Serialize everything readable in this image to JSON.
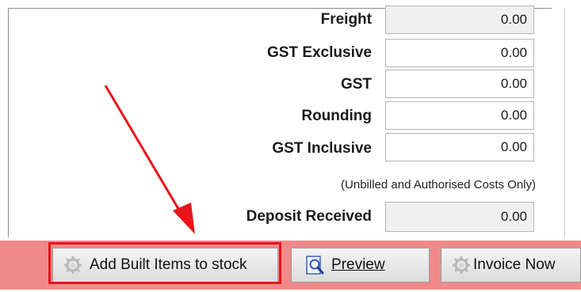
{
  "totals": {
    "freight": {
      "label": "Freight",
      "value": "0.00"
    },
    "gst_exclusive": {
      "label": "GST Exclusive",
      "value": "0.00"
    },
    "gst": {
      "label": "GST",
      "value": "0.00"
    },
    "rounding": {
      "label": "Rounding",
      "value": "0.00"
    },
    "gst_inclusive": {
      "label": "GST Inclusive",
      "value": "0.00"
    }
  },
  "note": "(Unbilled and Authorised Costs Only)",
  "deposit": {
    "label": "Deposit Received",
    "value": "0.00"
  },
  "toolbar": {
    "add_built_label": "Add Built Items to stock",
    "preview_label": "Preview",
    "invoice_label": "Invoice Now"
  },
  "icons": {
    "add_built": "gear-icon",
    "preview": "preview-document-icon",
    "invoice": "gear-icon"
  },
  "colors": {
    "toolbar_background": "#f08a8a",
    "highlight_annotation": "#e8141a",
    "readonly_field": "#f0f0f0"
  }
}
